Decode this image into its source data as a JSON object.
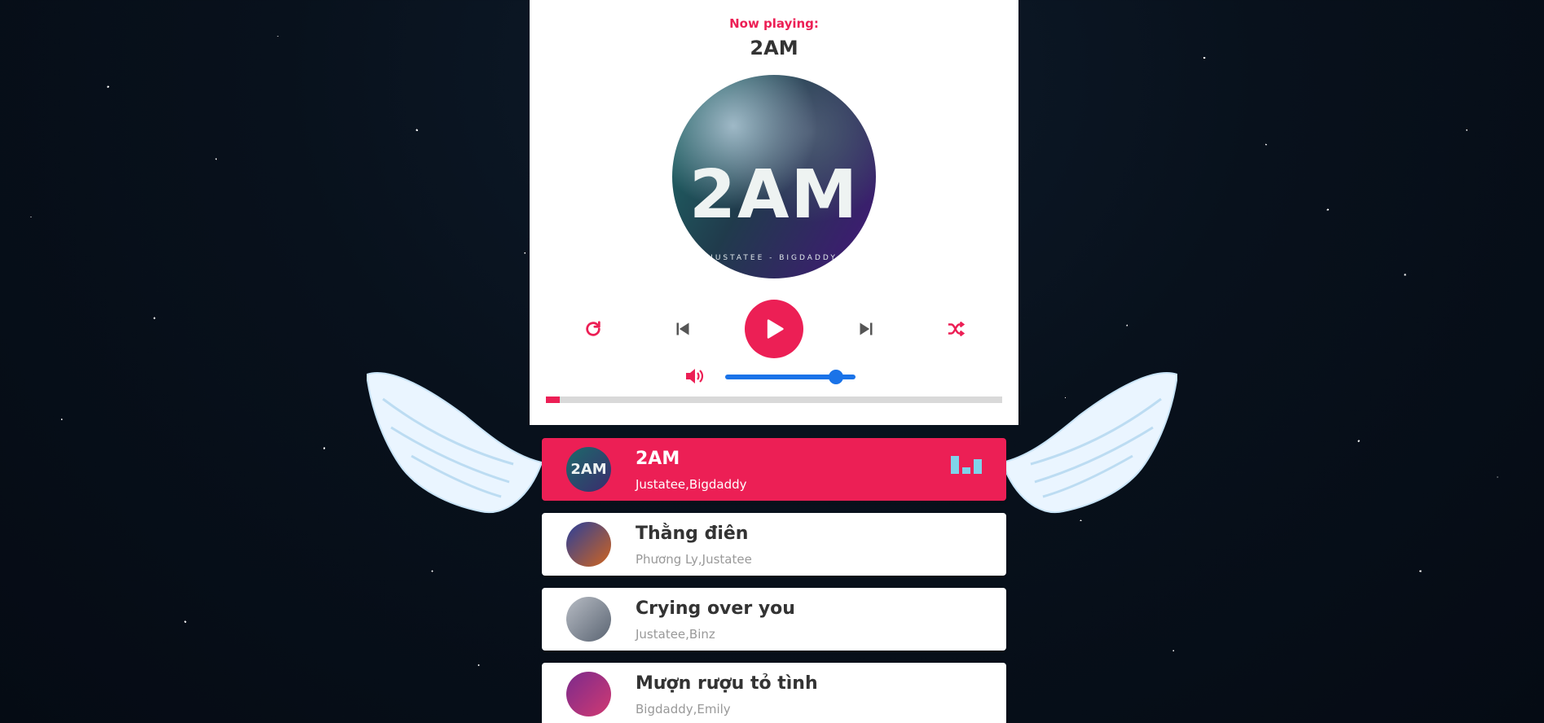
{
  "player": {
    "now_playing_label": "Now playing:",
    "current_title": "2AM",
    "cd": {
      "cover_text": "2AM",
      "cover_subtext": "JUSTATEE - BIGDADDY"
    },
    "controls": {
      "repeat_icon": "repeat-icon",
      "prev_icon": "previous-icon",
      "play_icon": "play-icon",
      "next_icon": "next-icon",
      "shuffle_icon": "shuffle-icon"
    },
    "volume": {
      "icon": "volume-icon",
      "level": 0.85
    },
    "progress": 0.03
  },
  "playlist": [
    {
      "title": "2AM",
      "artist": "Justatee,Bigdaddy",
      "active": true,
      "thumb_colors": [
        "#1c6a6a",
        "#3b2b6e"
      ],
      "thumb_text": "2AM"
    },
    {
      "title": "Thằng điên",
      "artist": "Phương Ly,Justatee",
      "active": false,
      "thumb_colors": [
        "#2a3f9a",
        "#d0641f"
      ],
      "thumb_text": ""
    },
    {
      "title": "Crying over you",
      "artist": "Justatee,Binz",
      "active": false,
      "thumb_colors": [
        "#b7bcc4",
        "#5a6472"
      ],
      "thumb_text": ""
    },
    {
      "title": "Mượn rượu tỏ tình",
      "artist": "Bigdaddy,Emily",
      "active": false,
      "thumb_colors": [
        "#7b2a8c",
        "#d13a72"
      ],
      "thumb_text": ""
    }
  ],
  "theme": {
    "accent": "#ec1f55",
    "volume_color": "#1a73e8",
    "progress_track": "#d9d9d9"
  }
}
